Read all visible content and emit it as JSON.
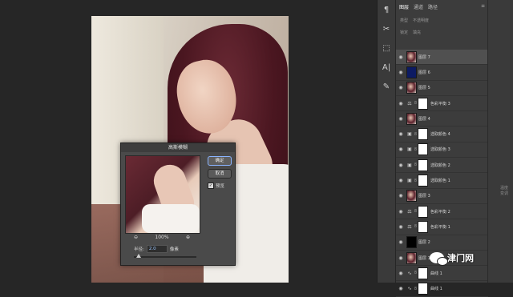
{
  "tabs": [
    "图层",
    "通道",
    "路径"
  ],
  "panel_menu": "≡",
  "filter_row": {
    "type_label": "类型",
    "opacity_label": "不透明度"
  },
  "lock_row": {
    "lock_label": "锁定",
    "fill_label": "填充"
  },
  "tools": [
    "paragraph-icon",
    "scissors-icon",
    "cube-icon",
    "text-a-icon",
    "brush-icon"
  ],
  "tool_glyphs": [
    "¶",
    "✂",
    "⬚",
    "A|",
    "✎"
  ],
  "layers": [
    {
      "name": "图层 7",
      "thumb": "photo",
      "selected": true
    },
    {
      "name": "图层 6",
      "thumb": "navy"
    },
    {
      "name": "图层 5",
      "thumb": "photo"
    },
    {
      "name": "色彩平衡 3",
      "adj": "balance"
    },
    {
      "name": "图层 4",
      "thumb": "photo"
    },
    {
      "name": "选取颜色 4",
      "adj": "selective"
    },
    {
      "name": "选取颜色 3",
      "adj": "selective"
    },
    {
      "name": "选取颜色 2",
      "adj": "selective"
    },
    {
      "name": "选取颜色 1",
      "adj": "selective"
    },
    {
      "name": "图层 3",
      "thumb": "photo"
    },
    {
      "name": "色彩平衡 2",
      "adj": "balance"
    },
    {
      "name": "色彩平衡 1",
      "adj": "balance"
    },
    {
      "name": "图层 2",
      "thumb": "black"
    },
    {
      "name": "图层 1",
      "thumb": "photo"
    },
    {
      "name": "曲线 1",
      "adj": "curves"
    },
    {
      "name": "曲线 1",
      "adj": "curves"
    }
  ],
  "dialog": {
    "title": "高斯模糊",
    "ok": "确定",
    "cancel": "取消",
    "preview_label": "预览",
    "preview_checked": true,
    "zoom_value": "100%",
    "zoom_out": "⊖",
    "zoom_in": "⊕",
    "radius_label": "半径:",
    "radius_value": "2.0",
    "radius_unit": "像素"
  },
  "watermark": "津门网",
  "side_text": "温度变调"
}
